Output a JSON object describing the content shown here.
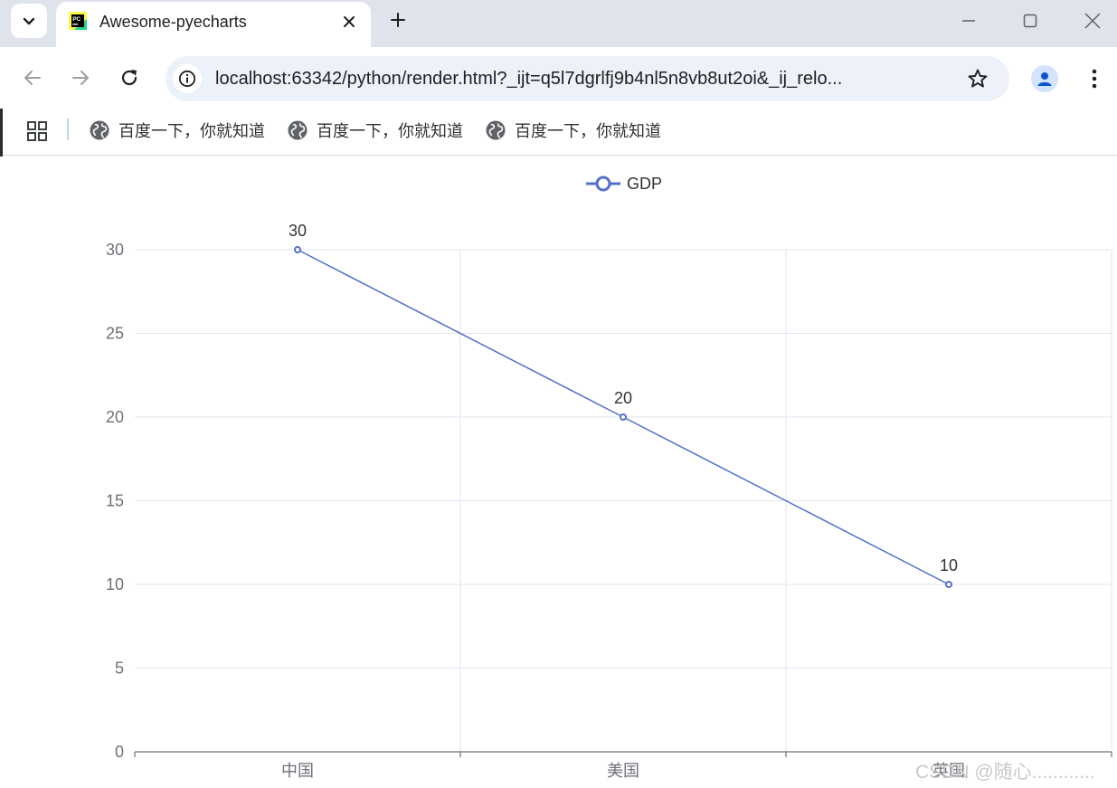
{
  "browser": {
    "tab": {
      "title": "Awesome-pyecharts",
      "favicon": "pycharm-icon"
    },
    "url": "localhost:63342/python/render.html?_ijt=q5l7dgrlfj9b4nl5n8vb8ut2oi&_ij_relo...",
    "bookmarks": [
      {
        "label": "百度一下，你就知道",
        "icon": "globe-icon"
      },
      {
        "label": "百度一下，你就知道",
        "icon": "globe-icon"
      },
      {
        "label": "百度一下，你就知道",
        "icon": "globe-icon"
      }
    ],
    "colors": {
      "tabstrip": "#dfe3eb",
      "omnibox": "#edf2fa",
      "profile": "#0b57d0"
    }
  },
  "chart_data": {
    "type": "line",
    "categories": [
      "中国",
      "美国",
      "英国"
    ],
    "series": [
      {
        "name": "GDP",
        "values": [
          30,
          20,
          10
        ],
        "color": "#5470c6"
      }
    ],
    "yticks": [
      0,
      5,
      10,
      15,
      20,
      25,
      30
    ],
    "ylim": [
      0,
      30
    ],
    "legend": "top-center",
    "grid": true,
    "data_labels": true
  },
  "watermark": "CSDN @随心............"
}
